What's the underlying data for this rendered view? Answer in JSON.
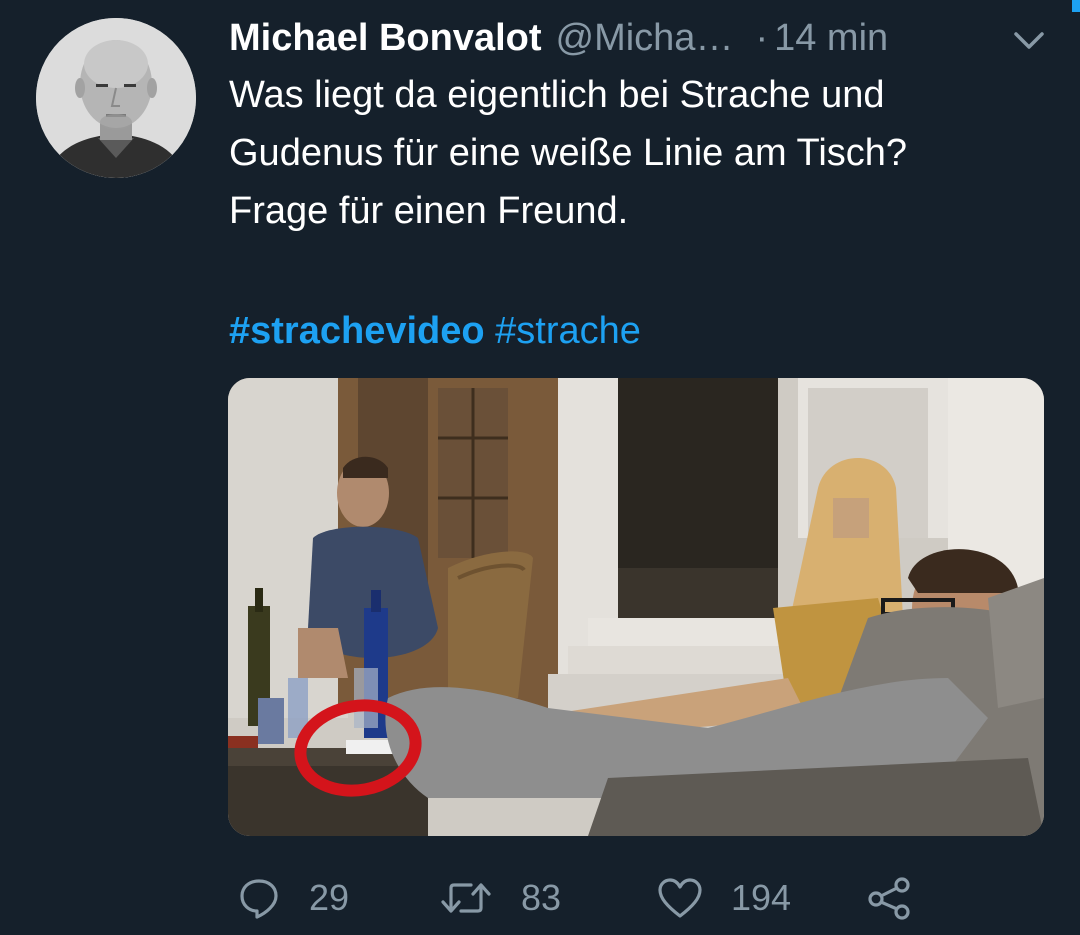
{
  "tweet": {
    "author": {
      "display_name": "Michael Bonvalot",
      "handle": "@Micha…"
    },
    "separator": "·",
    "timestamp": "14 min",
    "text_lines": [
      "Was liegt da eigentlich bei Strache und",
      "Gudenus für eine weiße Linie am Tisch?",
      "Frage für einen Freund."
    ],
    "hashtags": [
      "#strachevideo",
      "#strache"
    ],
    "media": {
      "annotation": "red-circle",
      "annotation_color": "#d4141b"
    },
    "actions": {
      "reply_count": "29",
      "retweet_count": "83",
      "like_count": "194"
    }
  },
  "colors": {
    "background": "#15202b",
    "text_primary": "#ffffff",
    "text_secondary": "#8899a6",
    "link": "#1da1f2"
  },
  "icons": {
    "reply": "reply-icon",
    "retweet": "retweet-icon",
    "like": "heart-icon",
    "share": "share-icon",
    "menu": "chevron-down-icon"
  }
}
